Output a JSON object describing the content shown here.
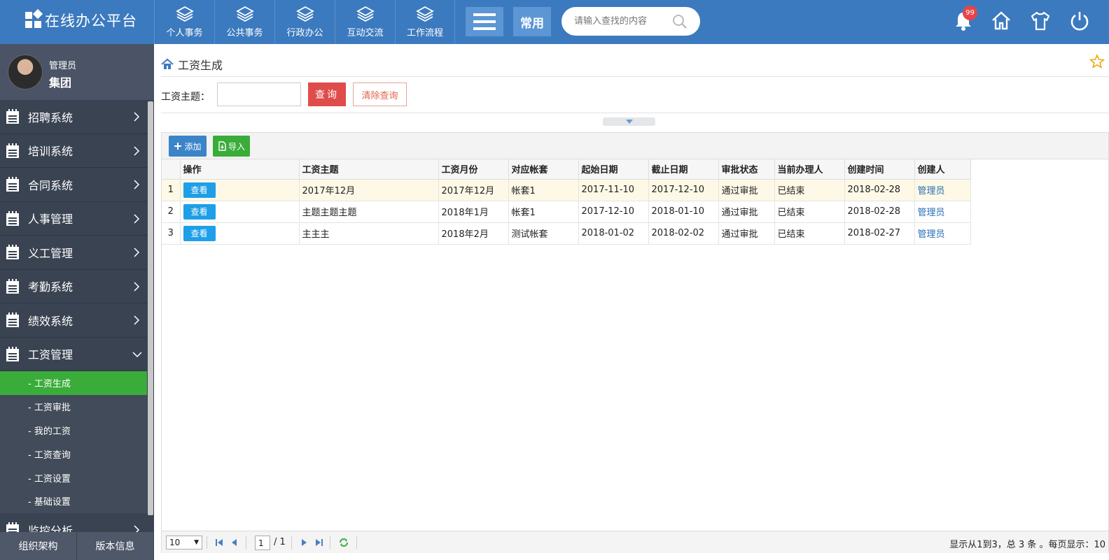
{
  "app": {
    "title": "在线办公平台"
  },
  "nav": {
    "tabs": [
      {
        "label": "个人事务",
        "icon": "layers-icon"
      },
      {
        "label": "公共事务",
        "icon": "layers-icon"
      },
      {
        "label": "行政办公",
        "icon": "layers-icon"
      },
      {
        "label": "互动交流",
        "icon": "layers-icon"
      },
      {
        "label": "工作流程",
        "icon": "layers-icon"
      }
    ],
    "common_label": "常用",
    "search_placeholder": "请输入查找的内容",
    "notification_count": "99"
  },
  "user": {
    "role": "管理员",
    "org": "集团"
  },
  "sidebar": {
    "items": [
      {
        "label": "招聘系统"
      },
      {
        "label": "培训系统"
      },
      {
        "label": "合同系统"
      },
      {
        "label": "人事管理"
      },
      {
        "label": "义工管理"
      },
      {
        "label": "考勤系统"
      },
      {
        "label": "绩效系统"
      },
      {
        "label": "工资管理"
      }
    ],
    "subitems": [
      {
        "label": "- 工资生成"
      },
      {
        "label": "- 工资审批"
      },
      {
        "label": "- 我的工资"
      },
      {
        "label": "- 工资查询"
      },
      {
        "label": "- 工资设置"
      },
      {
        "label": "- 基础设置"
      }
    ],
    "next_item": {
      "label": "监控分析"
    },
    "footer": {
      "org_label": "组织架构",
      "version_label": "版本信息"
    }
  },
  "page": {
    "breadcrumb": "工资生成",
    "filter_label": "工资主题：",
    "filter_value": "",
    "query_label": "查询",
    "clear_label": "清除查询",
    "add_label": "添加",
    "import_label": "导入"
  },
  "table": {
    "columns": [
      "操作",
      "工资主题",
      "工资月份",
      "对应帐套",
      "起始日期",
      "截止日期",
      "审批状态",
      "当前办理人",
      "创建时间",
      "创建人"
    ],
    "view_label": "查看",
    "rows": [
      {
        "num": "1",
        "subject": "2017年12月",
        "month": "2017年12月",
        "account": "帐套1",
        "start": "2017-11-10",
        "end": "2017-12-10",
        "status": "通过审批",
        "handler": "已结束",
        "created": "2018-02-28",
        "creator": "管理员"
      },
      {
        "num": "2",
        "subject": "主题主题主题",
        "month": "2018年1月",
        "account": "帐套1",
        "start": "2017-12-10",
        "end": "2018-01-10",
        "status": "通过审批",
        "handler": "已结束",
        "created": "2018-02-28",
        "creator": "管理员"
      },
      {
        "num": "3",
        "subject": "主主主",
        "month": "2018年2月",
        "account": "测试帐套",
        "start": "2018-01-02",
        "end": "2018-02-02",
        "status": "通过审批",
        "handler": "已结束",
        "created": "2018-02-27",
        "creator": "管理员"
      }
    ]
  },
  "pager": {
    "page_size": "10",
    "current_page": "1",
    "total_pages": "/ 1",
    "info": "显示从1到3，总 3 条 。每页显示：10"
  },
  "colors": {
    "topbar": "#3c7abf",
    "sidebar": "#3a4352",
    "active_green": "#3aac3a",
    "query_red": "#e04c4c",
    "view_blue": "#1e9fe8"
  }
}
